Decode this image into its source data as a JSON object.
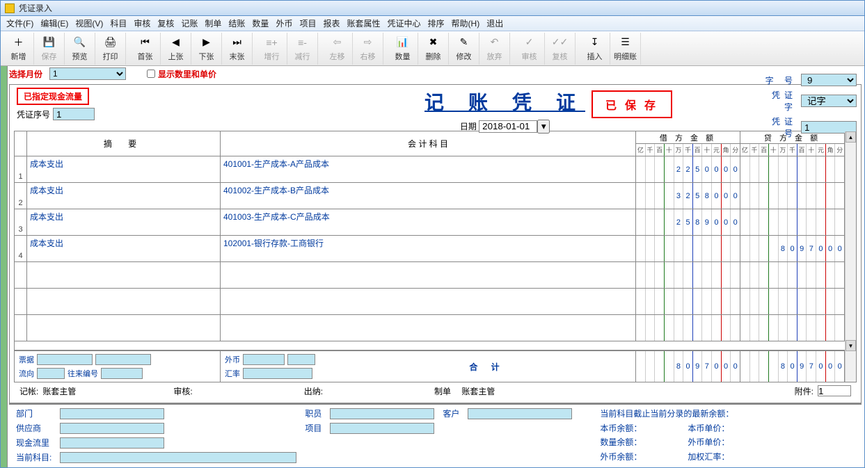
{
  "window_title": "凭证录入",
  "menubar": [
    "文件(F)",
    "编辑(E)",
    "视图(V)",
    "科目",
    "审核",
    "复核",
    "记账",
    "制单",
    "结账",
    "数量",
    "外币",
    "项目",
    "报表",
    "账套属性",
    "凭证中心",
    "排序",
    "帮助(H)",
    "退出"
  ],
  "toolbar": [
    {
      "label": "新增",
      "icon": "＋",
      "disabled": false
    },
    {
      "label": "保存",
      "icon": "💾",
      "disabled": true
    },
    {
      "label": "预览",
      "icon": "🔍",
      "disabled": false
    },
    {
      "label": "打印",
      "icon": "🖨",
      "disabled": false
    },
    {
      "label": "首张",
      "icon": "⏮",
      "disabled": false
    },
    {
      "label": "上张",
      "icon": "◀",
      "disabled": false
    },
    {
      "label": "下张",
      "icon": "▶",
      "disabled": false
    },
    {
      "label": "末张",
      "icon": "⏭",
      "disabled": false
    },
    {
      "label": "增行",
      "icon": "≡+",
      "disabled": true
    },
    {
      "label": "减行",
      "icon": "≡-",
      "disabled": true
    },
    {
      "label": "左移",
      "icon": "⇦",
      "disabled": true
    },
    {
      "label": "右移",
      "icon": "⇨",
      "disabled": true
    },
    {
      "label": "数量",
      "icon": "📊",
      "disabled": false
    },
    {
      "label": "删除",
      "icon": "✖",
      "disabled": false
    },
    {
      "label": "修改",
      "icon": "✎",
      "disabled": false
    },
    {
      "label": "放弃",
      "icon": "↶",
      "disabled": true
    },
    {
      "label": "审核",
      "icon": "✓",
      "disabled": true
    },
    {
      "label": "复核",
      "icon": "✓✓",
      "disabled": true
    },
    {
      "label": "插入",
      "icon": "↧",
      "disabled": false
    },
    {
      "label": "明细账",
      "icon": "☰",
      "disabled": false
    }
  ],
  "panel": {
    "month_label": "选择月份",
    "month_value": "1",
    "show_qty_label": "显示数里和单价",
    "cashflow_box": "已指定现金流量",
    "seq_label": "凭证序号",
    "seq_value": "1",
    "voucher_title": "记 账 凭 证",
    "date_label": "日期",
    "date_value": "2018-01-01",
    "saved_stamp": "已 保 存",
    "num_label": "字  号",
    "num_value": "9",
    "word_label": "凭证字",
    "word_value": "记字",
    "vno_label": "凭证号",
    "vno_value": "1"
  },
  "grid": {
    "col_summary": "摘   要",
    "col_account": "会 计 科 目",
    "col_debit": "借 方 金 额",
    "col_credit": "贷 方 金 额",
    "digit_heads": [
      "亿",
      "千",
      "百",
      "十",
      "万",
      "千",
      "百",
      "十",
      "元",
      "角",
      "分"
    ],
    "rows": [
      {
        "n": "1",
        "summary": "成本支出",
        "account": "401001-生产成本-A产品成本",
        "debit": [
          "",
          "",
          "",
          "",
          "2",
          "2",
          "5",
          "0",
          "0",
          "0",
          "0"
        ],
        "credit": [
          "",
          "",
          "",
          "",
          "",
          "",
          "",
          "",
          "",
          "",
          ""
        ]
      },
      {
        "n": "2",
        "summary": "成本支出",
        "account": "401002-生产成本-B产品成本",
        "debit": [
          "",
          "",
          "",
          "",
          "3",
          "2",
          "5",
          "8",
          "0",
          "0",
          "0"
        ],
        "credit": [
          "",
          "",
          "",
          "",
          "",
          "",
          "",
          "",
          "",
          "",
          ""
        ]
      },
      {
        "n": "3",
        "summary": "成本支出",
        "account": "401003-生产成本-C产品成本",
        "debit": [
          "",
          "",
          "",
          "",
          "2",
          "5",
          "8",
          "9",
          "0",
          "0",
          "0"
        ],
        "credit": [
          "",
          "",
          "",
          "",
          "",
          "",
          "",
          "",
          "",
          "",
          ""
        ]
      },
      {
        "n": "4",
        "summary": "成本支出",
        "account": "102001-银行存款-工商银行",
        "debit": [
          "",
          "",
          "",
          "",
          "",
          "",
          "",
          "",
          "",
          "",
          ""
        ],
        "credit": [
          "",
          "",
          "",
          "",
          "8",
          "0",
          "9",
          "7",
          "0",
          "0",
          "0"
        ]
      }
    ],
    "footer": {
      "bill_label": "票据",
      "fx_label": "外币",
      "flow_label": "流向",
      "peer_label": "往来编号",
      "rate_label": "汇率",
      "total_label": "合   计",
      "debit_total": [
        "",
        "",
        "",
        "",
        "8",
        "0",
        "9",
        "7",
        "0",
        "0",
        "0"
      ],
      "credit_total": [
        "",
        "",
        "",
        "",
        "8",
        "0",
        "9",
        "7",
        "0",
        "0",
        "0"
      ]
    }
  },
  "signatures": {
    "book_label": "记帐:",
    "book_val": "账套主管",
    "audit_label": "审核:",
    "cashier_label": "出纳:",
    "maker_label": "制单",
    "maker_val": "账套主管",
    "attach_label": "附件:",
    "attach_val": "1"
  },
  "bottom": {
    "dept": "部门",
    "staff": "职员",
    "cust": "客户",
    "supplier": "供应商",
    "project": "项目",
    "cashflow": "现金流里",
    "cur_acct": "当前科目:",
    "bal_title": "当前科目截止当前分录的最新余额：",
    "r1a": "本币余额：",
    "r1b": "本币单价：",
    "r2a": "数量余额：",
    "r2b": "外币单价：",
    "r3a": "外币余额：",
    "r3b": "加权汇率："
  }
}
